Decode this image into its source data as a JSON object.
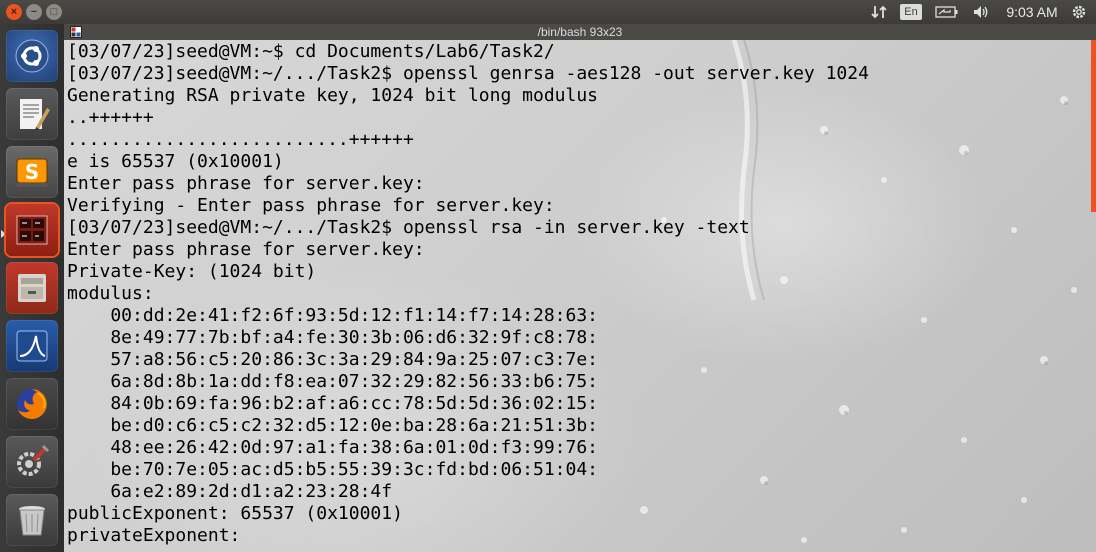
{
  "top_panel": {
    "language": "En",
    "clock": "9:03 AM"
  },
  "terminal": {
    "title": "/bin/bash 93x23",
    "lines": [
      "[03/07/23]seed@VM:~$ cd Documents/Lab6/Task2/",
      "[03/07/23]seed@VM:~/.../Task2$ openssl genrsa -aes128 -out server.key 1024",
      "Generating RSA private key, 1024 bit long modulus",
      "..++++++",
      "..........................++++++",
      "e is 65537 (0x10001)",
      "Enter pass phrase for server.key:",
      "Verifying - Enter pass phrase for server.key:",
      "[03/07/23]seed@VM:~/.../Task2$ openssl rsa -in server.key -text",
      "Enter pass phrase for server.key:",
      "Private-Key: (1024 bit)",
      "modulus:",
      "    00:dd:2e:41:f2:6f:93:5d:12:f1:14:f7:14:28:63:",
      "    8e:49:77:7b:bf:a4:fe:30:3b:06:d6:32:9f:c8:78:",
      "    57:a8:56:c5:20:86:3c:3a:29:84:9a:25:07:c3:7e:",
      "    6a:8d:8b:1a:dd:f8:ea:07:32:29:82:56:33:b6:75:",
      "    84:0b:69:fa:96:b2:af:a6:cc:78:5d:5d:36:02:15:",
      "    be:d0:c6:c5:c2:32:d5:12:0e:ba:28:6a:21:51:3b:",
      "    48:ee:26:42:0d:97:a1:fa:38:6a:01:0d:f3:99:76:",
      "    be:70:7e:05:ac:d5:b5:55:39:3c:fd:bd:06:51:04:",
      "    6a:e2:89:2d:d1:a2:23:28:4f",
      "publicExponent: 65537 (0x10001)",
      "privateExponent:"
    ]
  },
  "launcher": {
    "items": [
      {
        "name": "ubuntu-dash-icon",
        "active": false
      },
      {
        "name": "text-editor-icon",
        "active": false
      },
      {
        "name": "sublime-text-icon",
        "active": false
      },
      {
        "name": "terminal-app-icon",
        "active": true
      },
      {
        "name": "file-manager-icon",
        "active": false
      },
      {
        "name": "wireshark-icon",
        "active": false
      },
      {
        "name": "firefox-icon",
        "active": false
      },
      {
        "name": "system-settings-icon",
        "active": false
      },
      {
        "name": "trash-icon",
        "active": false
      }
    ]
  },
  "colors": {
    "accent": "#e95420",
    "panel": "#3c3b37"
  }
}
